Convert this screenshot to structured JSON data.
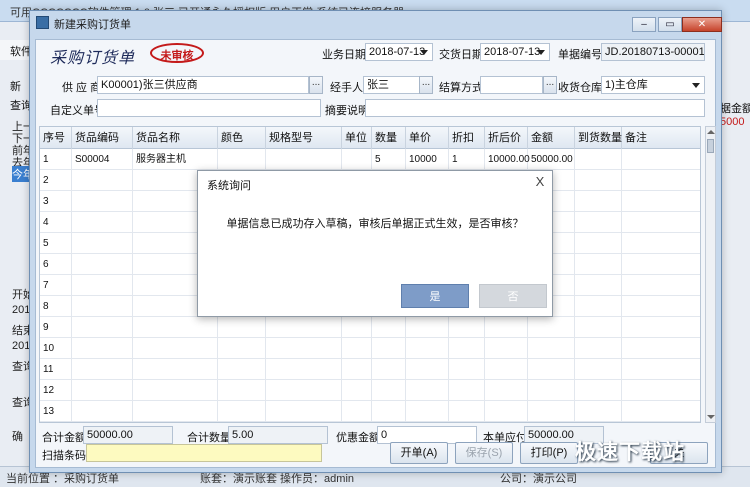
{
  "background": {
    "title": "可用CCCCCCC软件管理 1.0   张三 已开通永久授权版 用户正常   系统已连接服务器",
    "menu_label": "软件",
    "new_label": "新",
    "query_label": "查询",
    "side_items": [
      "上一",
      "下一",
      "前年",
      "去年",
      "今年"
    ],
    "side_lower": [
      "开始",
      "2018",
      "结束",
      "2018",
      "查询",
      "查询"
    ],
    "confirm_label": "确",
    "right_items": [
      "据金额",
      "5000"
    ],
    "status_items": [
      "当前位置 ：采购订货单",
      "账套：演示账套  操作员：admin",
      "公司：演示公司"
    ]
  },
  "window": {
    "title": "新建采购订货单",
    "minimize": "–",
    "restore": "▭",
    "close": "✕"
  },
  "form": {
    "title": "采购订货单",
    "stamp": "未审核",
    "biz_date_label": "业务日期",
    "biz_date": "2018-07-13",
    "delivery_date_label": "交货日期",
    "delivery_date": "2018-07-13",
    "doc_no_label": "单据编号",
    "doc_no": "JD.20180713-00001",
    "supplier_label": "供 应 商",
    "supplier": "K00001)张三供应商",
    "handler_label": "经手人",
    "handler": "张三",
    "settle_label": "结算方式",
    "settle": "",
    "warehouse_label": "收货仓库",
    "warehouse": "1)主仓库",
    "custom_no_label": "自定义单号",
    "custom_no": "",
    "summary_label": "摘要说明",
    "summary": "",
    "ellipsis": "..."
  },
  "grid": {
    "columns": [
      "序号",
      "货品编码",
      "货品名称",
      "颜色",
      "规格型号",
      "单位",
      "数量",
      "单价",
      "折扣",
      "折后价",
      "金额",
      "到货数量",
      "备注"
    ],
    "rows": [
      [
        "1",
        "S00004",
        "服务器主机",
        "",
        "",
        "",
        "5",
        "10000",
        "1",
        "10000.00",
        "50000.00",
        "",
        ""
      ],
      [
        "2",
        "",
        "",
        "",
        "",
        "",
        "",
        "",
        "",
        "",
        "",
        "",
        ""
      ],
      [
        "3",
        "",
        "",
        "",
        "",
        "",
        "",
        "",
        "",
        "",
        "",
        "",
        ""
      ],
      [
        "4",
        "",
        "",
        "",
        "",
        "",
        "",
        "",
        "",
        "",
        "",
        "",
        ""
      ],
      [
        "5",
        "",
        "",
        "",
        "",
        "",
        "",
        "",
        "",
        "",
        "",
        "",
        ""
      ],
      [
        "6",
        "",
        "",
        "",
        "",
        "",
        "",
        "",
        "",
        "",
        "",
        "",
        ""
      ],
      [
        "7",
        "",
        "",
        "",
        "",
        "",
        "",
        "",
        "",
        "",
        "",
        "",
        ""
      ],
      [
        "8",
        "",
        "",
        "",
        "",
        "",
        "",
        "",
        "",
        "",
        "",
        "",
        ""
      ],
      [
        "9",
        "",
        "",
        "",
        "",
        "",
        "",
        "",
        "",
        "",
        "",
        "",
        ""
      ],
      [
        "10",
        "",
        "",
        "",
        "",
        "",
        "",
        "",
        "",
        "",
        "",
        "",
        ""
      ],
      [
        "11",
        "",
        "",
        "",
        "",
        "",
        "",
        "",
        "",
        "",
        "",
        "",
        ""
      ],
      [
        "12",
        "",
        "",
        "",
        "",
        "",
        "",
        "",
        "",
        "",
        "",
        "",
        ""
      ],
      [
        "13",
        "",
        "",
        "",
        "",
        "",
        "",
        "",
        "",
        "",
        "",
        "",
        ""
      ]
    ]
  },
  "totals": {
    "amount_label": "合计金额",
    "amount": "50000.00",
    "qty_label": "合计数量",
    "qty": "5.00",
    "discount_label": "优惠金额",
    "discount": "0",
    "payable_label": "本单应付",
    "payable": "50000.00"
  },
  "footer": {
    "scan_label": "扫描条码",
    "open_btn": "开单(A)",
    "save_btn": "保存(S)",
    "print_btn": "打印(P)",
    "close_btn": "关"
  },
  "dialog": {
    "title": "系统询问",
    "message": "单据信息已成功存入草稿，审核后单据正式生效，是否审核？",
    "yes": "是",
    "no": "否",
    "close": "X"
  },
  "watermark": "极速下载站"
}
